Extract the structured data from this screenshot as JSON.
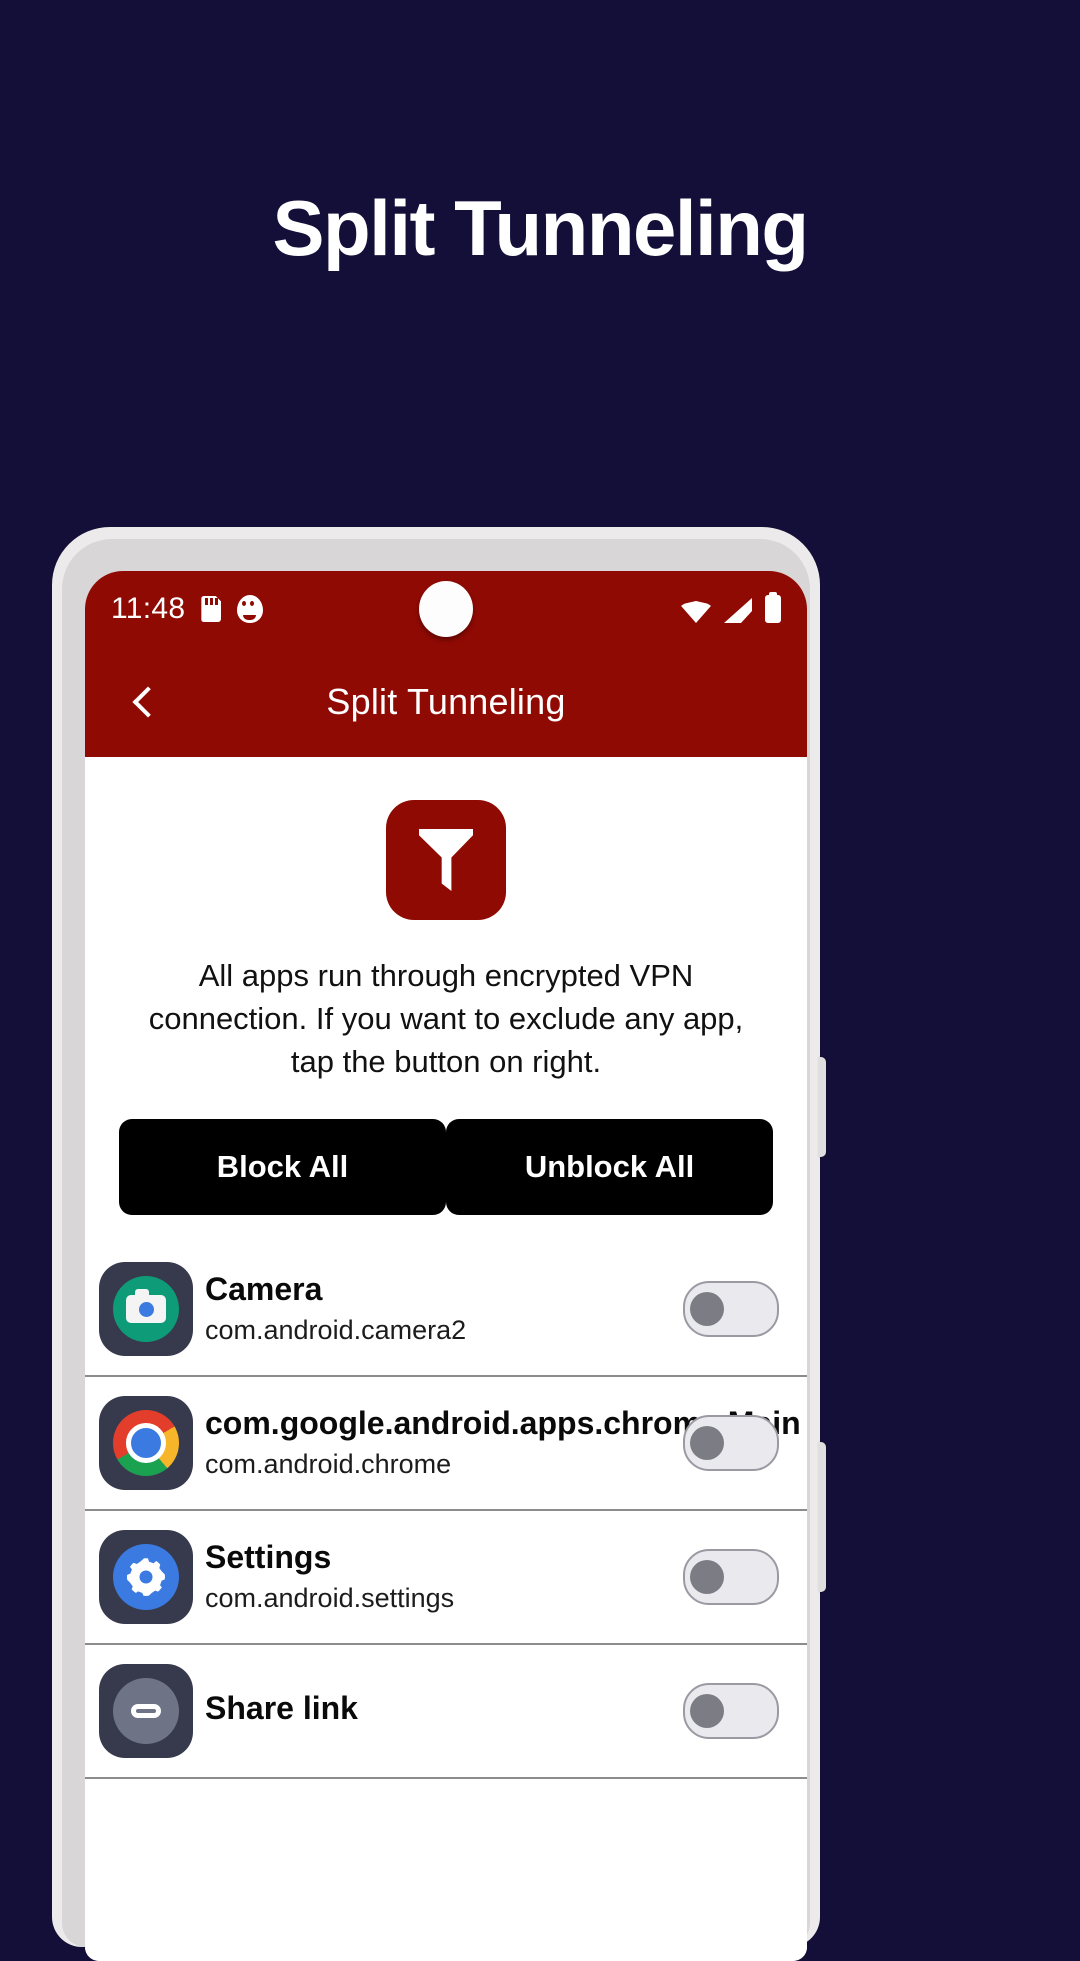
{
  "hero": {
    "title": "Split Tunneling"
  },
  "colors": {
    "page_background": "#130F38",
    "brand_red": "#900A04",
    "button_black": "#000000",
    "screen_white": "#FFFFFF"
  },
  "phone": {
    "status_bar": {
      "time": "11:48",
      "left_icons": [
        "sd-card-icon",
        "pet-face-icon"
      ],
      "right_icons": [
        "wifi-icon",
        "cellular-signal-icon",
        "battery-icon"
      ]
    },
    "app_bar": {
      "back_icon": "chevron-left-icon",
      "title": "Split Tunneling"
    },
    "hero_icon": "funnel-icon",
    "description": "All apps run through encrypted VPN connection. If you want to exclude any app, tap the button on right.",
    "buttons": {
      "block_all": "Block All",
      "unblock_all": "Unblock All"
    },
    "app_list": [
      {
        "name": "Camera",
        "package": "com.android.camera2",
        "icon": "camera-app-icon",
        "toggle_on": false
      },
      {
        "name": "com.google.android.apps.chrome.Main",
        "package": "com.android.chrome",
        "icon": "chrome-app-icon",
        "toggle_on": false
      },
      {
        "name": "Settings",
        "package": "com.android.settings",
        "icon": "settings-app-icon",
        "toggle_on": false
      },
      {
        "name": "Share link",
        "package": "",
        "icon": "share-link-app-icon",
        "toggle_on": false
      }
    ]
  }
}
